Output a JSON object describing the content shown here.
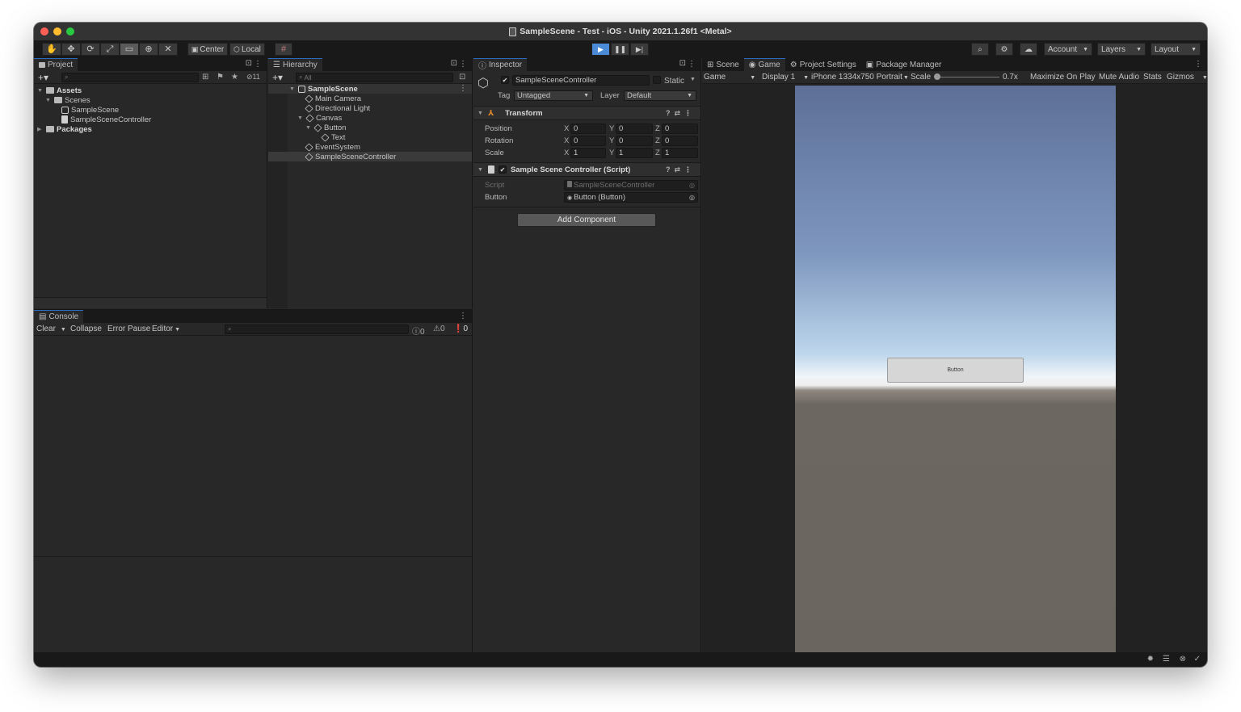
{
  "window": {
    "title": "SampleScene - Test - iOS - Unity 2021.1.26f1 <Metal>"
  },
  "toolbar": {
    "tools": [
      "hand-icon",
      "move-icon",
      "rotate-icon",
      "scale-icon",
      "rect-icon",
      "transform-icon",
      "custom-tool-icon"
    ],
    "pivot_label": "Center",
    "space_label": "Local",
    "account_label": "Account",
    "layers_label": "Layers",
    "layout_label": "Layout"
  },
  "project": {
    "tab_label": "Project",
    "hidden_count": "11",
    "tree": {
      "assets": "Assets",
      "scenes": "Scenes",
      "sample_scene": "SampleScene",
      "controller": "SampleSceneController",
      "packages": "Packages"
    }
  },
  "hierarchy": {
    "tab_label": "Hierarchy",
    "search_placeholder": "All",
    "tree": {
      "scene": "SampleScene",
      "main_camera": "Main Camera",
      "directional_light": "Directional Light",
      "canvas": "Canvas",
      "button": "Button",
      "text": "Text",
      "event_system": "EventSystem",
      "controller": "SampleSceneController"
    }
  },
  "console": {
    "tab_label": "Console",
    "clear": "Clear",
    "collapse": "Collapse",
    "error_pause": "Error Pause",
    "editor": "Editor",
    "info_count": "0",
    "warning_count": "0",
    "error_count": "0"
  },
  "inspector": {
    "tab_label": "Inspector",
    "object_name": "SampleSceneController",
    "static_label": "Static",
    "tag_label": "Tag",
    "tag_value": "Untagged",
    "layer_label": "Layer",
    "layer_value": "Default",
    "transform": {
      "title": "Transform",
      "position_label": "Position",
      "rotation_label": "Rotation",
      "scale_label": "Scale",
      "x_label": "X",
      "y_label": "Y",
      "z_label": "Z",
      "position": {
        "x": "0",
        "y": "0",
        "z": "0"
      },
      "rotation": {
        "x": "0",
        "y": "0",
        "z": "0"
      },
      "scale": {
        "x": "1",
        "y": "1",
        "z": "1"
      }
    },
    "script_component": {
      "title": "Sample Scene Controller (Script)",
      "script_label": "Script",
      "script_value": "SampleSceneController",
      "button_label": "Button",
      "button_value": "Button (Button)"
    },
    "add_component": "Add Component"
  },
  "game": {
    "tabs": {
      "scene": "Scene",
      "game": "Game",
      "project_settings": "Project Settings",
      "package_manager": "Package Manager"
    },
    "mode": "Game",
    "display": "Display 1",
    "resolution": "iPhone 1334x750 Portrait",
    "scale_label": "Scale",
    "scale_value": "0.7x",
    "maximize": "Maximize On Play",
    "mute": "Mute Audio",
    "stats": "Stats",
    "gizmos": "Gizmos",
    "button_text": "Button"
  }
}
